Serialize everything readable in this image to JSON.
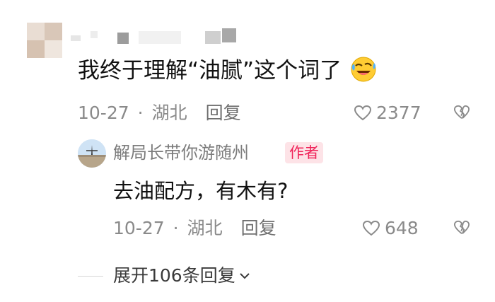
{
  "comment": {
    "text": "我终于理解“油腻”这个词了",
    "emoji_icon": "rolling-laughing-face-icon",
    "date": "10-27",
    "separator": "·",
    "location": "湖北",
    "reply_label": "回复",
    "likes": "2377",
    "like_icon": "heart-outline-icon",
    "dislike_icon": "broken-heart-icon"
  },
  "reply": {
    "author_name": "解局长带你游随州",
    "author_badge": "作者",
    "text": "去油配方，有木有?",
    "date": "10-27",
    "separator": "·",
    "location": "湖北",
    "reply_label": "回复",
    "likes": "648",
    "like_icon": "heart-outline-icon",
    "dislike_icon": "broken-heart-icon"
  },
  "expand": {
    "label": "展开106条回复",
    "chevron_icon": "chevron-down-icon"
  },
  "colors": {
    "text_primary": "#111111",
    "text_secondary": "#8a8a8a",
    "badge_text": "#f0245a",
    "badge_bg": "#fde3e7"
  }
}
